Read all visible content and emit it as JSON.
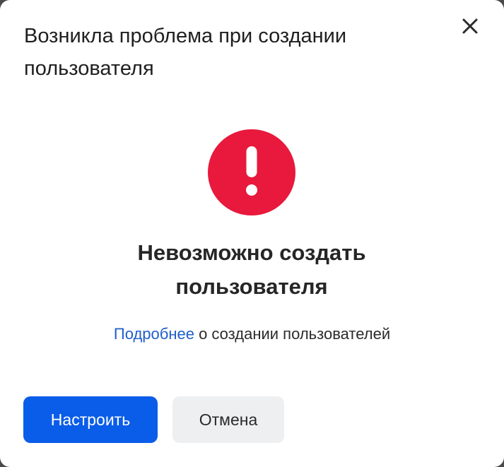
{
  "dialog": {
    "title": "Возникла проблема при создании пользователя",
    "close_icon": "close-icon",
    "error_icon": "exclamation-circle-icon",
    "error_color": "#e8193c",
    "heading": "Невозможно создать пользователя",
    "info_link_text": "Подробнее",
    "info_rest_text": " о создании пользователей",
    "primary_button_label": "Настроить",
    "secondary_button_label": "Отмена",
    "accent_color": "#0a5de8",
    "link_color": "#1f5fc9"
  }
}
